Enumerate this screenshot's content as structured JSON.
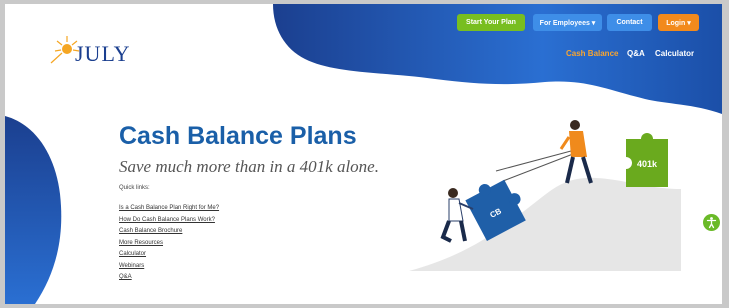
{
  "header": {
    "logo_text": "JULY",
    "buttons": {
      "start": "Start Your Plan",
      "employees": "For Employees ▾",
      "contact": "Contact",
      "login": "Login ▾"
    },
    "nav": {
      "cash_balance": "Cash Balance",
      "qa": "Q&A",
      "calculator": "Calculator"
    }
  },
  "hero": {
    "title": "Cash Balance Plans",
    "subtitle": "Save much more than in a 401k alone.",
    "quick_links_label": "Quick links:",
    "quick_links": [
      "Is a Cash Balance Plan Right for Me?",
      "How Do Cash Balance Plans Work?",
      "Cash Balance Brochure",
      "More Resources",
      "Calculator",
      "Webinars",
      "Q&A"
    ]
  },
  "illustration": {
    "puzzle_cb_label": "CB",
    "puzzle_401k_label": "401k"
  },
  "colors": {
    "navy": "#1a3f8c",
    "blue": "#2a6dd0",
    "green": "#78be20",
    "orange": "#f28a1c",
    "title_blue": "#1a5fa8"
  }
}
